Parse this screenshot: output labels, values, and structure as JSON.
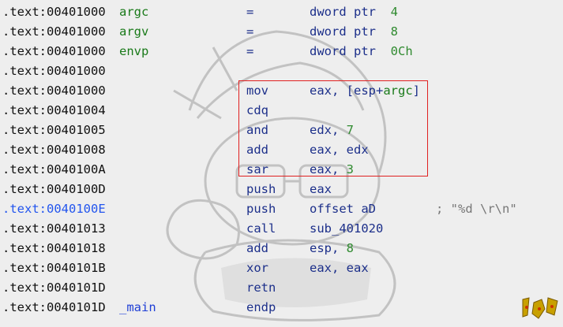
{
  "listing": [
    {
      "addr": ".text:00401000",
      "label": "argc",
      "mn": "=",
      "op": [
        {
          "t": "dword ptr  "
        },
        {
          "t": "4",
          "c": "num"
        }
      ]
    },
    {
      "addr": ".text:00401000",
      "label": "argv",
      "mn": "=",
      "op": [
        {
          "t": "dword ptr  "
        },
        {
          "t": "8",
          "c": "num"
        }
      ]
    },
    {
      "addr": ".text:00401000",
      "label": "envp",
      "mn": "=",
      "op": [
        {
          "t": "dword ptr  "
        },
        {
          "t": "0Ch",
          "c": "num"
        }
      ]
    },
    {
      "addr": ".text:00401000"
    },
    {
      "addr": ".text:00401000",
      "mn": "mov",
      "op": [
        {
          "t": "eax, [esp+"
        },
        {
          "t": "argc",
          "c": "sym"
        },
        {
          "t": "]"
        }
      ]
    },
    {
      "addr": ".text:00401004",
      "mn": "cdq"
    },
    {
      "addr": ".text:00401005",
      "mn": "and",
      "op": [
        {
          "t": "edx, "
        },
        {
          "t": "7",
          "c": "num"
        }
      ]
    },
    {
      "addr": ".text:00401008",
      "mn": "add",
      "op": [
        {
          "t": "eax, edx"
        }
      ]
    },
    {
      "addr": ".text:0040100A",
      "mn": "sar",
      "op": [
        {
          "t": "eax, "
        },
        {
          "t": "3",
          "c": "num"
        }
      ]
    },
    {
      "addr": ".text:0040100D",
      "mn": "push",
      "op": [
        {
          "t": "eax"
        }
      ]
    },
    {
      "addr": ".text:0040100E",
      "addr_highlight": true,
      "mn": "push",
      "op": [
        {
          "t": "offset aD"
        }
      ],
      "comment": "; \"%d \\r\\n\""
    },
    {
      "addr": ".text:00401013",
      "mn": "call",
      "op": [
        {
          "t": "sub_401020"
        }
      ]
    },
    {
      "addr": ".text:00401018",
      "mn": "add",
      "op": [
        {
          "t": "esp, "
        },
        {
          "t": "8",
          "c": "num"
        }
      ]
    },
    {
      "addr": ".text:0040101B",
      "mn": "xor",
      "op": [
        {
          "t": "eax, eax"
        }
      ]
    },
    {
      "addr": ".text:0040101D",
      "mn": "retn"
    },
    {
      "addr": ".text:0040101D",
      "label": "_main",
      "label_kind": "proc",
      "mn": "endp"
    }
  ],
  "highlight_box": {
    "color": "#e02020",
    "first_line": 4,
    "last_line": 8
  },
  "colors": {
    "background": "#eeeeee",
    "address": "#111111",
    "address_selected": "#2255ee",
    "label": "#1a7a1a",
    "mnemonic": "#1c2f8a",
    "number": "#2f8a2f",
    "comment": "#777777"
  },
  "icons": {
    "background_art": "cartoon-character-watermark",
    "corner_mark": "decorative-stamp"
  }
}
